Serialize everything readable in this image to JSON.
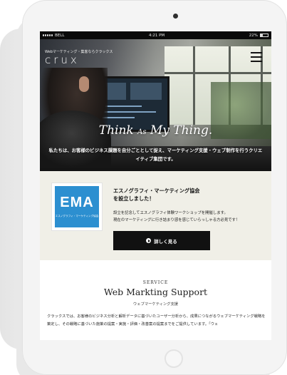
{
  "status_bar": {
    "carrier": "BELL",
    "time": "4:21 PM",
    "battery": "22%"
  },
  "header": {
    "logo_tagline": "Webマーケティング・集客ならクラックス",
    "logo": "crux",
    "menu_icon": "hamburger-menu-icon"
  },
  "hero": {
    "tagline_think": "Think",
    "tagline_as": "As",
    "tagline_my": "My Thing.",
    "description": "私たちは、お客様のビジネス課題を自分ごととして捉え、マーケティング支援・ウェブ制作を行うクリエイティブ集団です。"
  },
  "notice": {
    "logo_text": "EMA",
    "logo_sub": "エスノグラフィ・マーケティング協会",
    "title_line1": "エスノグラフィ・マーケティング協会",
    "title_line2": "を設立しました！",
    "body_line1": "設立を記念してエスノグラフィ体験ワークショップを開催します。",
    "body_line2": "現在のマーケティングに行き詰まり感を感じていらっしゃる方必見です！",
    "button_label": "詳しく見る"
  },
  "service": {
    "eyebrow": "SERVICE",
    "title": "Web Markting Support",
    "subtitle": "ウェブマーケティング支援",
    "body": "クラックスでは、お客様のビジネス分析と解析データに基づいたユーザー分析から、成果につながるウェブマーケティング戦略を策定し、その戦略に基づいた施策の提案・実施・評価・改善案の提案までをご提供しています。「ウェ"
  },
  "colors": {
    "ema_blue": "#2c8fd0",
    "notice_bg": "#f0efe7",
    "button_bg": "#111111"
  }
}
